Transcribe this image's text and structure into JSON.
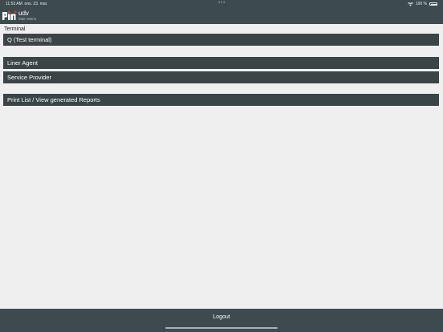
{
  "status_bar": {
    "time": "11:53 AM",
    "date": "ons. 23. mar.",
    "dots": "•••",
    "battery_text": "100 %"
  },
  "header": {
    "app_title": "udv",
    "subtitle": "Main Menu",
    "logo_icon": "pin-logo-icon"
  },
  "terminal": {
    "label": "Terminal",
    "value": "Q (Test terminal)"
  },
  "menu": {
    "liner_agent": "Liner Agent",
    "service_provider": "Service Provider",
    "print_list": "Print List / View generated Reports"
  },
  "footer": {
    "logout_label": "Logout"
  },
  "colors": {
    "header_bg": "#3d4b4f",
    "bar_bg": "#3b4547",
    "page_bg": "#efefef"
  }
}
